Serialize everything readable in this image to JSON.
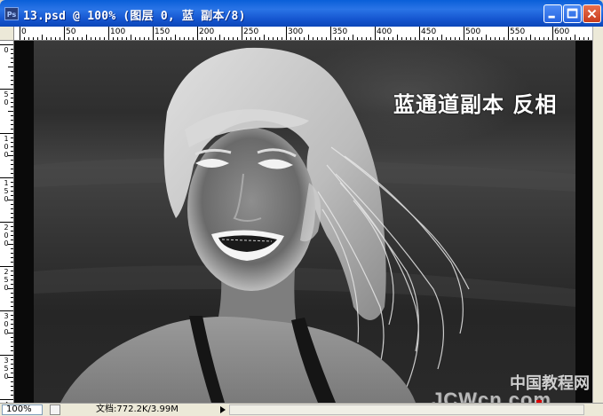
{
  "window": {
    "title": "13.psd @ 100% (图层 0, 蓝 副本/8)",
    "app_icon": "Ps",
    "controls": [
      "minimize-icon",
      "maximize-icon",
      "close-icon"
    ]
  },
  "rulers": {
    "horizontal_labels": [
      "0",
      "50",
      "100",
      "150",
      "200",
      "250",
      "300",
      "350",
      "400",
      "450",
      "500",
      "550",
      "600"
    ],
    "vertical_labels": [
      "0",
      "5 0",
      "1 0 0",
      "1 5 0",
      "2 0 0",
      "2 5 0",
      "3 0 0",
      "3 5 0",
      "4 0 0"
    ]
  },
  "canvas": {
    "caption": "蓝通道副本   反相",
    "watermark_cn": "中国教程网",
    "watermark_en": "JCWcn.com"
  },
  "status": {
    "zoom": "100%",
    "doc_info": "文档:772.2K/3.99M"
  },
  "colors": {
    "titlebar": "#1657d1",
    "close_button": "#c83c1c",
    "canvas_bg": "#0a0a0a"
  }
}
